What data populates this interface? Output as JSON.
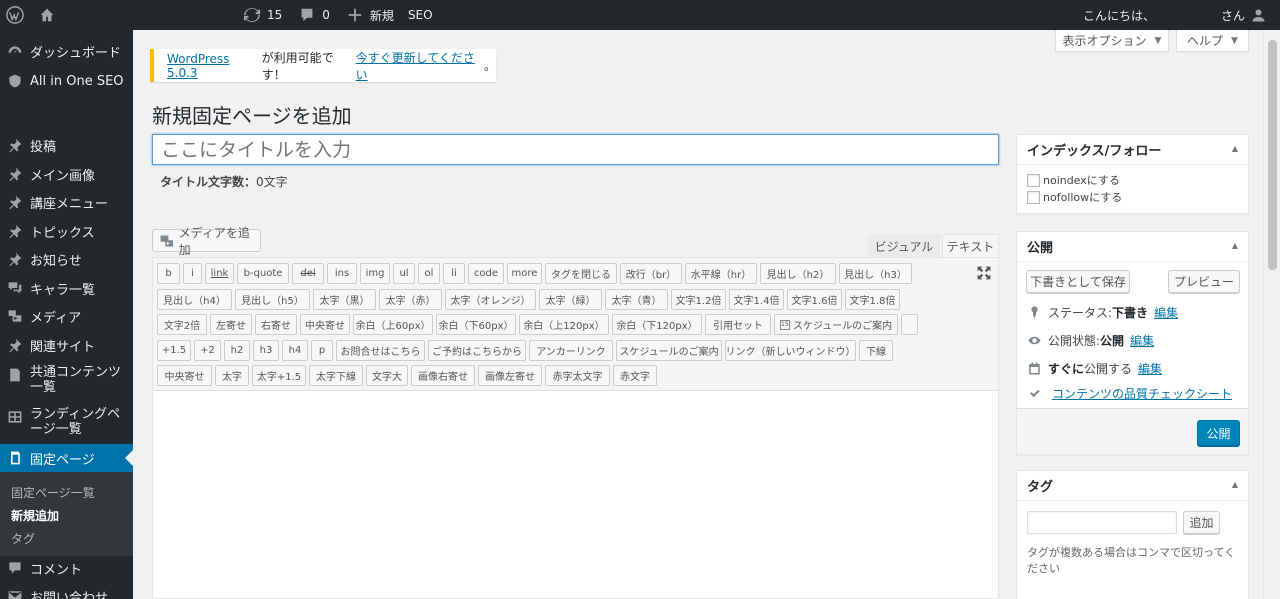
{
  "adminbar": {
    "updates_count": "15",
    "comments_count": "0",
    "new_label": "新規",
    "seo_label": "SEO",
    "howdy_prefix": "こんにちは、",
    "howdy_suffix": "さん"
  },
  "sidebar": {
    "items": [
      {
        "label": "ダッシュボード",
        "icon": "dashboard-icon"
      },
      {
        "label": "All in One SEO",
        "icon": "shield-icon"
      },
      {
        "label": "投稿",
        "icon": "pin-icon"
      },
      {
        "label": "メイン画像",
        "icon": "pin-icon"
      },
      {
        "label": "講座メニュー",
        "icon": "pin-icon"
      },
      {
        "label": "トピックス",
        "icon": "pin-icon"
      },
      {
        "label": "お知らせ",
        "icon": "pin-icon"
      },
      {
        "label": "キャラ一覧",
        "icon": "comments-icon"
      },
      {
        "label": "メディア",
        "icon": "media-icon"
      },
      {
        "label": "関連サイト",
        "icon": "pin-icon"
      },
      {
        "label": "共通コンテンツ一覧",
        "icon": "document-icon"
      },
      {
        "label": "ランディングページ一覧",
        "icon": "grid-icon"
      },
      {
        "label": "固定ページ",
        "icon": "page-icon"
      },
      {
        "label": "コメント",
        "icon": "comment-icon"
      },
      {
        "label": "お問い合わせ",
        "icon": "mail-icon"
      }
    ],
    "submenu": [
      "固定ページ一覧",
      "新規追加",
      "タグ"
    ]
  },
  "screen_options_label": "表示オプション",
  "help_label": "ヘルプ",
  "notice": {
    "link_version": "WordPress 5.0.3",
    "middle": " が利用可能です！",
    "link_update": "今すぐ更新してください",
    "end": "。"
  },
  "page_title": "新規固定ページを追加",
  "title_placeholder": "ここにタイトルを入力",
  "title_count_label": "タイトル文字数：",
  "title_count_value": "0文字",
  "media_button": "メディアを追加",
  "tabs": {
    "visual": "ビジュアル",
    "text": "テキスト"
  },
  "quicktags": [
    [
      "b",
      "i",
      "link",
      "b-quote",
      "del",
      "ins",
      "img",
      "ul",
      "ol",
      "li",
      "code",
      "more",
      "タグを閉じる",
      "改行（br）",
      "水平線（hr）",
      "見出し（h2）",
      "見出し（h3）"
    ],
    [
      "見出し（h4）",
      "見出し（h5）",
      "太字（黒）",
      "太字（赤）",
      "太字（オレンジ）",
      "太字（緑）",
      "太字（青）",
      "文字1.2倍",
      "文字1.4倍",
      "文字1.6倍",
      "文字1.8倍"
    ],
    [
      "文字2倍",
      "左寄せ",
      "右寄せ",
      "中央寄せ",
      "余白（上60px）",
      "余白（下60px）",
      "余白（上120px）",
      "余白（下120px）",
      "引用セット",
      "スケジュールのご案内",
      ""
    ],
    [
      "+1.5",
      "+2",
      "h2",
      "h3",
      "h4",
      "p",
      "お問合せはこちら",
      "ご予約はこちらから",
      "アンカーリンク",
      "スケジュールのご案内",
      "リンク（新しいウィンドウ）",
      "下線"
    ],
    [
      "中央寄せ",
      "太字",
      "太字+1.5",
      "太字下線",
      "文字大",
      "画像右寄せ",
      "画像左寄せ",
      "赤字太文字",
      "赤文字"
    ]
  ],
  "index_box": {
    "title": "インデックス/フォロー",
    "options": [
      "noindexにする",
      "nofollowにする"
    ]
  },
  "publish_box": {
    "title": "公開",
    "save_draft": "下書きとして保存",
    "preview": "プレビュー",
    "status_label": "ステータス: ",
    "status_value": "下書き",
    "visibility_label": "公開状態: ",
    "visibility_value": "公開",
    "schedule_value": "すぐに",
    "schedule_suffix": "公開する",
    "edit": "編集",
    "checklist_link": "コンテンツの品質チェックシート",
    "publish_button": "公開"
  },
  "tag_box": {
    "title": "タグ",
    "add_button": "追加",
    "hint": "タグが複数ある場合はコンマで区切ってください"
  }
}
